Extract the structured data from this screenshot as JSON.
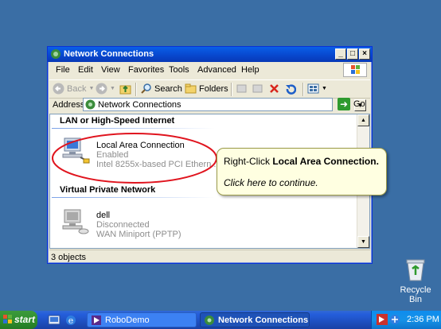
{
  "window": {
    "title": "Network Connections",
    "controls": {
      "minimize": "_",
      "maximize": "□",
      "close": "×"
    }
  },
  "menu": [
    "File",
    "Edit",
    "View",
    "Favorites",
    "Tools",
    "Advanced",
    "Help"
  ],
  "toolbar": {
    "back": "Back",
    "search": "Search",
    "folders": "Folders"
  },
  "address": {
    "label": "Address",
    "value": "Network Connections",
    "go": "Go"
  },
  "content": {
    "group1": "LAN or High-Speed Internet",
    "item1": {
      "name": "Local Area Connection",
      "status": "Enabled",
      "device": "Intel 8255x-based PCI Ethern..."
    },
    "group2": "Virtual Private Network",
    "item2": {
      "name": "dell",
      "status": "Disconnected",
      "device": "WAN Miniport (PPTP)"
    }
  },
  "status": {
    "text": "3 objects"
  },
  "callout": {
    "prefix": "Right-Click ",
    "target": "Local Area Connection.",
    "continue": "Click here to continue."
  },
  "desktop": {
    "recycle": "Recycle Bin"
  },
  "taskbar": {
    "start": "start",
    "tasks": [
      "RoboDemo",
      "Network Connections"
    ],
    "clock": "2:36 PM"
  },
  "colors": {
    "desktop": "#3A6EA5",
    "highlight_ellipse": "#E0141E",
    "callout_bg": "#FFFFE1"
  }
}
